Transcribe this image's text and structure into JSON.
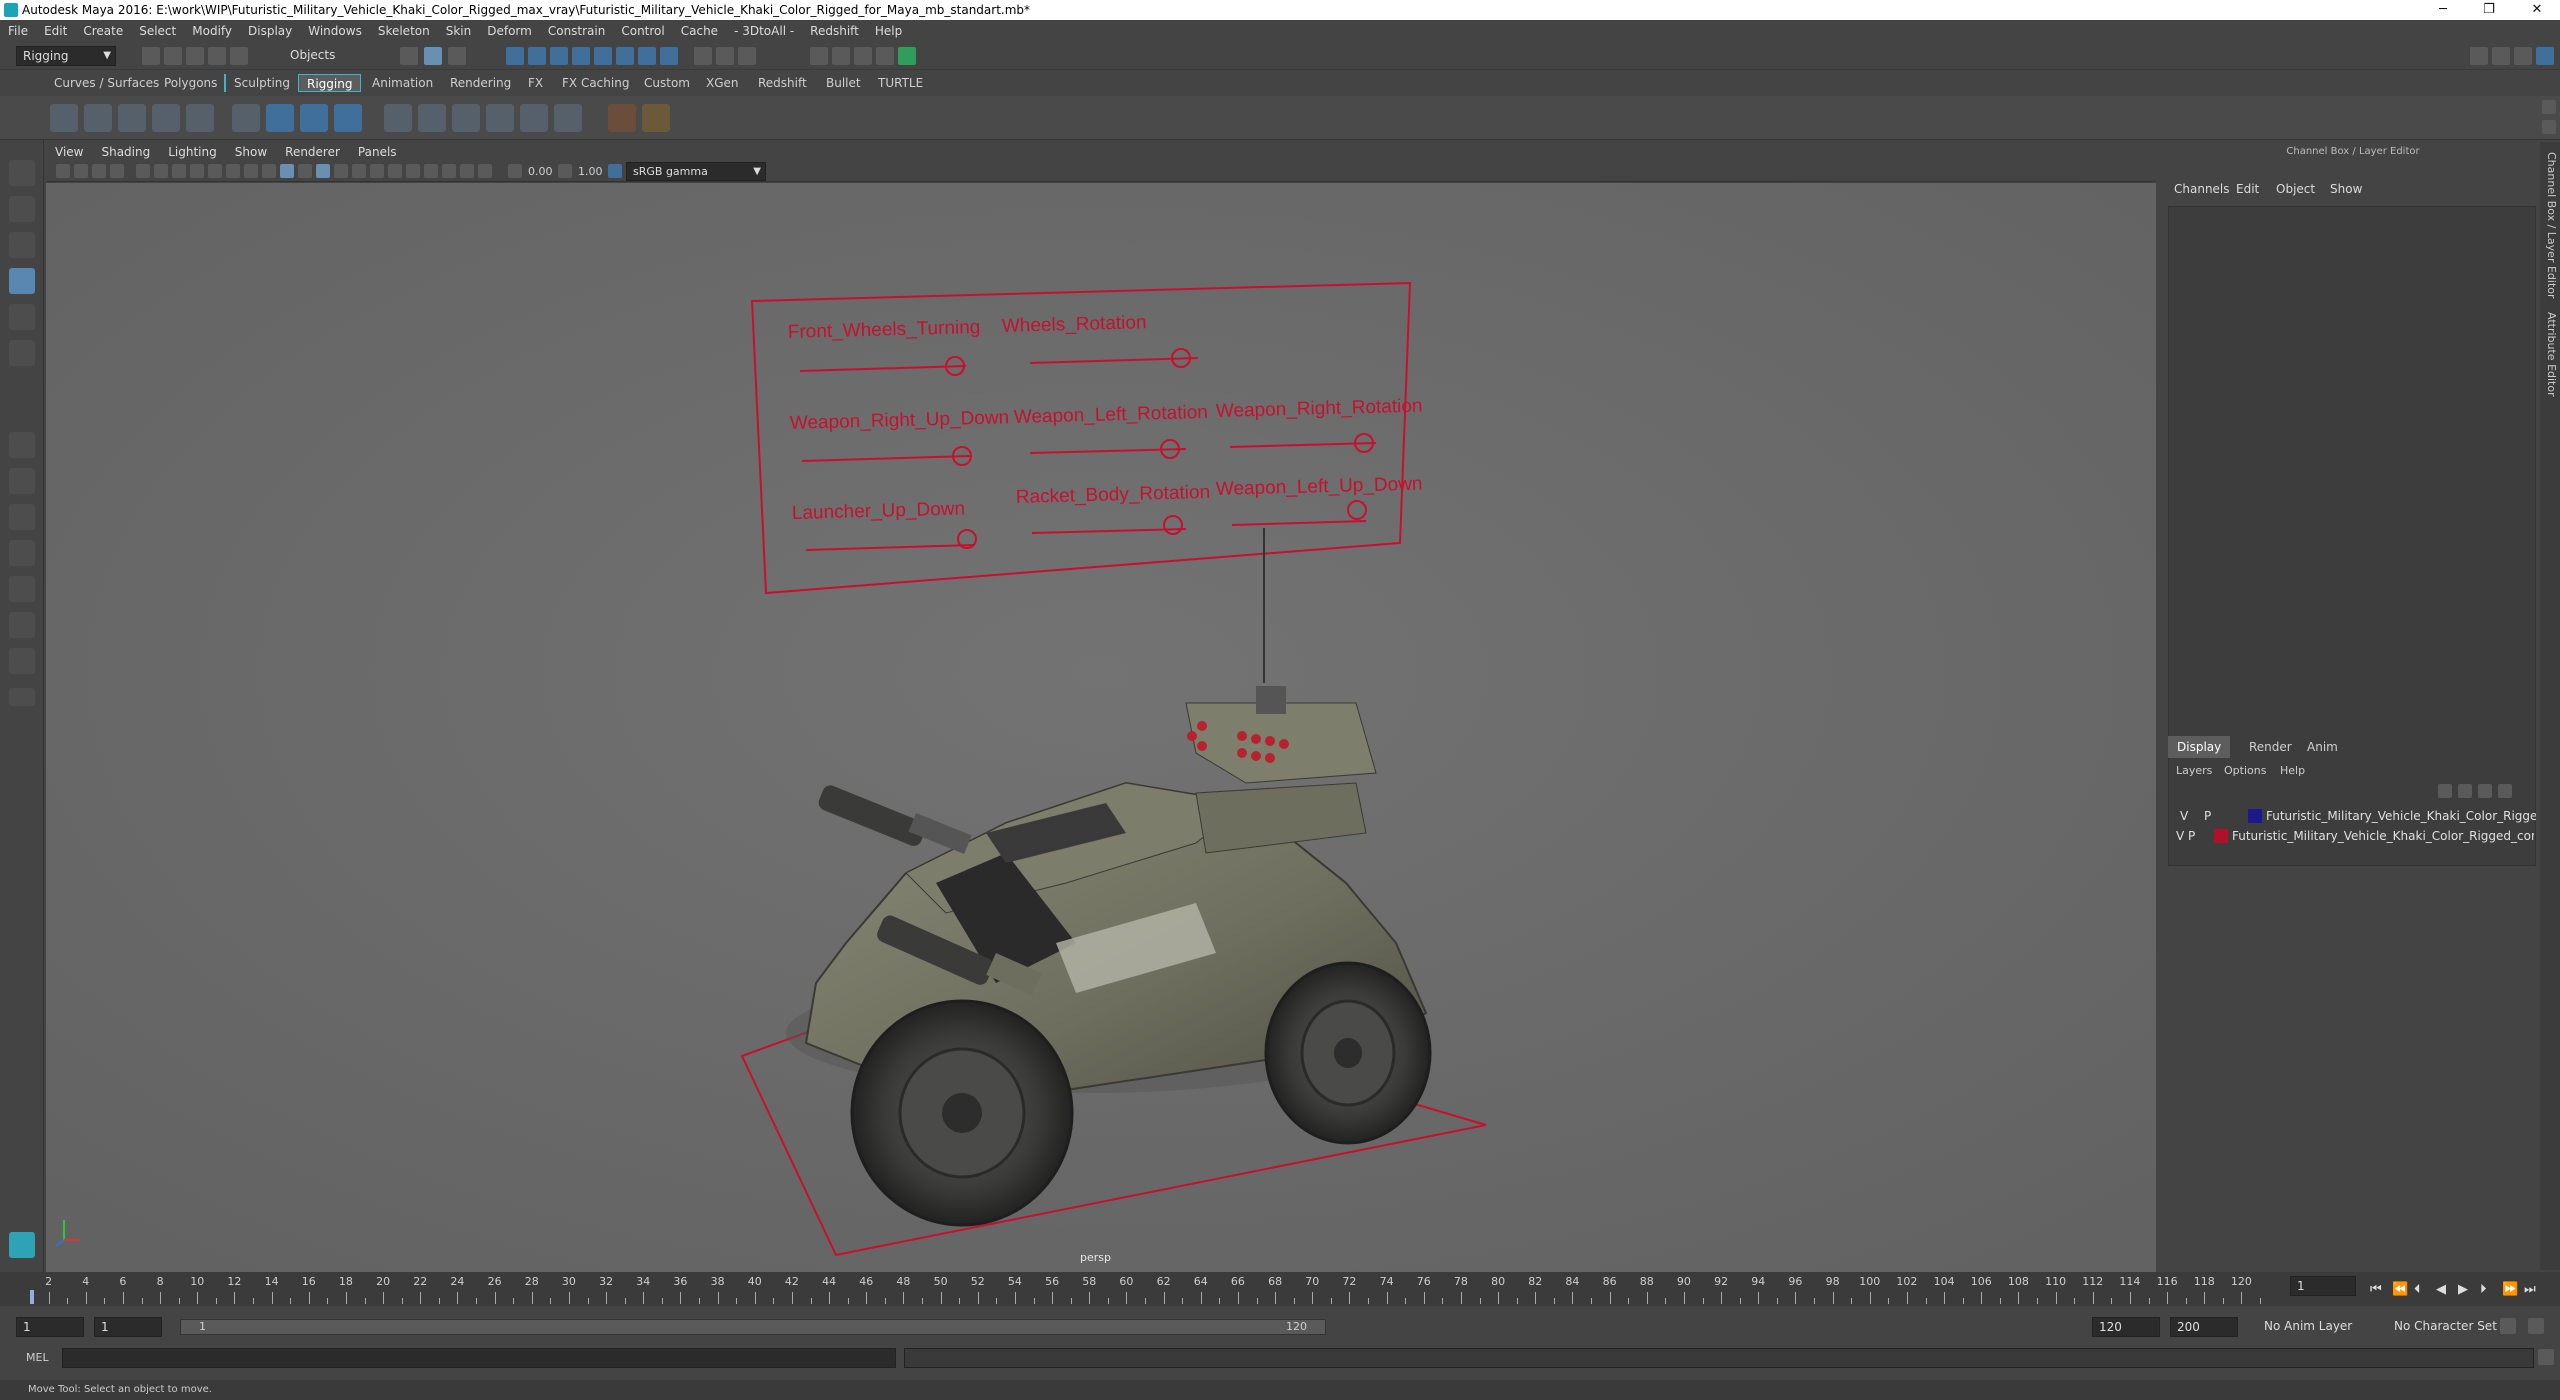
{
  "window": {
    "title": "Autodesk Maya 2016: E:\\work\\WIP\\Futuristic_Military_Vehicle_Khaki_Color_Rigged_max_vray\\Futuristic_Military_Vehicle_Khaki_Color_Rigged_for_Maya_mb_standart.mb*",
    "minimize": "─",
    "restore": "❐",
    "close": "✕"
  },
  "menubar": [
    "File",
    "Edit",
    "Create",
    "Select",
    "Modify",
    "Display",
    "Windows",
    "Skeleton",
    "Skin",
    "Deform",
    "Constrain",
    "Control",
    "Cache",
    "- 3DtoAll -",
    "Redshift",
    "Help"
  ],
  "statusline": {
    "mode": "Rigging",
    "select_mode": "Objects"
  },
  "shelf_tabs": [
    "Curves / Surfaces",
    "Polygons",
    "Sculpting",
    "Rigging",
    "Animation",
    "Rendering",
    "FX",
    "FX Caching",
    "Custom",
    "XGen",
    "Redshift",
    "Bullet",
    "TURTLE"
  ],
  "shelf_active_tab": "Rigging",
  "viewport": {
    "menu": [
      "View",
      "Shading",
      "Lighting",
      "Show",
      "Renderer",
      "Panels"
    ],
    "exposure": "0.00",
    "gamma": "1.00",
    "color_space": "sRGB gamma",
    "camera_label": "persp",
    "controls": {
      "front_wheels_turning": "Front_Wheels_Turning",
      "wheels_rotation": "Wheels_Rotation",
      "weapon_right_up_down": "Weapon_Right_Up_Down",
      "weapon_left_rotation": "Weapon_Left_Rotation",
      "weapon_right_rotation": "Weapon_Right_Rotation",
      "launcher_up_down": "Launcher_Up_Down",
      "racket_body_rotation": "Racket_Body_Rotation",
      "weapon_left_up_down": "Weapon_Left_Up_Down"
    }
  },
  "channel_box": {
    "header": "Channel Box / Layer Editor",
    "menu": [
      "Channels",
      "Edit",
      "Object",
      "Show"
    ]
  },
  "layer_editor": {
    "tabs": [
      "Display",
      "Render",
      "Anim"
    ],
    "active_tab": "Display",
    "menu": [
      "Layers",
      "Options",
      "Help"
    ],
    "layers": [
      {
        "v": "V",
        "p": "P",
        "color": "#1a1a8c",
        "name": "Futuristic_Military_Vehicle_Khaki_Color_Rigged"
      },
      {
        "v": "V",
        "p": "P",
        "color": "#b0102a",
        "name": "Futuristic_Military_Vehicle_Khaki_Color_Rigged_controllers"
      }
    ]
  },
  "side_tabs": [
    "Channel Box / Layer Editor",
    "Attribute Editor"
  ],
  "timeline": {
    "labels": [
      "2",
      "4",
      "6",
      "8",
      "10",
      "12",
      "14",
      "16",
      "18",
      "20",
      "22",
      "24",
      "26",
      "28",
      "30",
      "32",
      "34",
      "36",
      "38",
      "40",
      "42",
      "44",
      "46",
      "48",
      "50",
      "52",
      "54",
      "56",
      "58",
      "60",
      "62",
      "64",
      "66",
      "68",
      "70",
      "72",
      "74",
      "76",
      "78",
      "80",
      "82",
      "84",
      "86",
      "88",
      "90",
      "92",
      "94",
      "96",
      "98",
      "100",
      "102",
      "104",
      "106",
      "108",
      "110",
      "112",
      "114",
      "116",
      "118",
      "120"
    ],
    "current_frame": "1"
  },
  "range": {
    "start": "1",
    "playback_start": "1",
    "range_start_label": "1",
    "range_end_label": "120",
    "playback_end": "120",
    "end": "200",
    "anim_layer": "No Anim Layer",
    "character_set": "No Character Set"
  },
  "cmdline": {
    "lang": "MEL"
  },
  "helpline": "Move Tool: Select an object to move."
}
